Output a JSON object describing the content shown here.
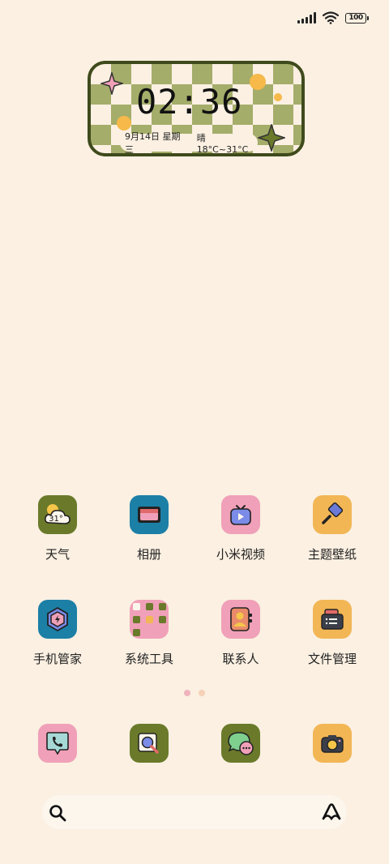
{
  "status_bar": {
    "battery": "100"
  },
  "clock_widget": {
    "time": "02:36",
    "date": "9月14日 星期三",
    "weather": "晴 18°C~31°C"
  },
  "weather_icon_temp": "31°",
  "apps": [
    {
      "label": "天气",
      "color": "#6a7a2a"
    },
    {
      "label": "相册",
      "color": "#1c7fa6"
    },
    {
      "label": "小米视频",
      "color": "#f0a0b8"
    },
    {
      "label": "主题壁纸",
      "color": "#f2b655"
    },
    {
      "label": "手机管家",
      "color": "#1c7fa6"
    },
    {
      "label": "系统工具",
      "color": "#f0a0b8"
    },
    {
      "label": "联系人",
      "color": "#f0a0b8"
    },
    {
      "label": "文件管理",
      "color": "#f2b655"
    }
  ],
  "dock": [
    {
      "name": "phone",
      "color": "#f0a0b8"
    },
    {
      "name": "browser",
      "color": "#6a7a2a"
    },
    {
      "name": "messages",
      "color": "#6a7a2a"
    },
    {
      "name": "camera",
      "color": "#f2b655"
    }
  ],
  "page_indicator": {
    "count": 2,
    "active": 0
  }
}
